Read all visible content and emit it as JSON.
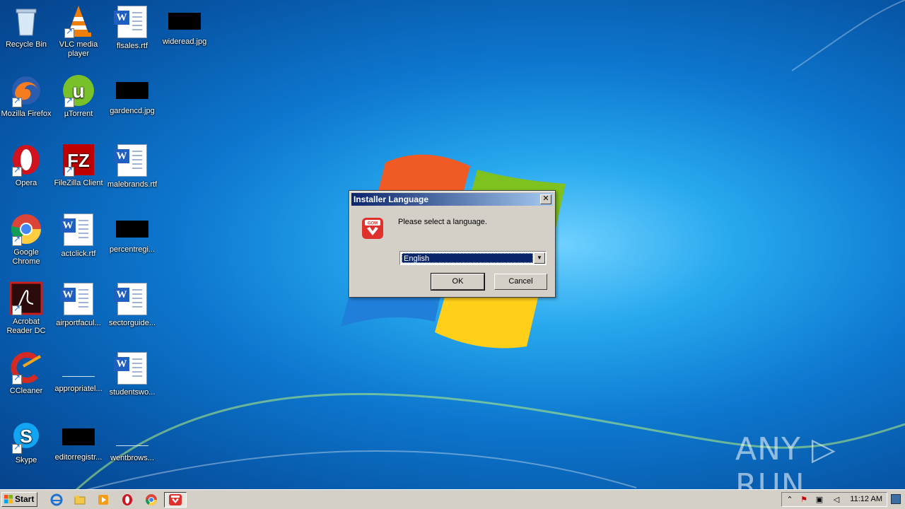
{
  "desktop": {
    "icons": [
      {
        "label": "Recycle Bin"
      },
      {
        "label": "VLC media player"
      },
      {
        "label": "flsales.rtf"
      },
      {
        "label": "wideread.jpg"
      },
      {
        "label": "Mozilla Firefox"
      },
      {
        "label": "µTorrent"
      },
      {
        "label": "gardencd.jpg"
      },
      {
        "label": "Opera"
      },
      {
        "label": "FileZilla Client"
      },
      {
        "label": "malebrands.rtf"
      },
      {
        "label": "Google Chrome"
      },
      {
        "label": "actclick.rtf"
      },
      {
        "label": "percentregi..."
      },
      {
        "label": "Acrobat Reader DC"
      },
      {
        "label": "airportfacul..."
      },
      {
        "label": "sectorguide..."
      },
      {
        "label": "CCleaner"
      },
      {
        "label": "appropriatel..."
      },
      {
        "label": "studentswo..."
      },
      {
        "label": "Skype"
      },
      {
        "label": "editorregistr..."
      },
      {
        "label": "wentbrows..."
      }
    ]
  },
  "dialog": {
    "title": "Installer Language",
    "close_glyph": "✕",
    "prompt": "Please select a language.",
    "language_select": {
      "value": "English"
    },
    "ok_label": "OK",
    "cancel_label": "Cancel"
  },
  "taskbar": {
    "start_label": "Start",
    "quick_launch": [
      "internet-explorer-icon",
      "windows-explorer-icon",
      "media-player-icon",
      "opera-icon",
      "chrome-icon"
    ],
    "active_app": "gom-player-installer",
    "tray": {
      "clock": "11:12 AM"
    }
  },
  "watermark": "ANY ▷ RUN",
  "colors": {
    "titlebar_start": "#0a246a",
    "titlebar_end": "#a6caf0",
    "dialog_bg": "#d4d0c8",
    "gom_red": "#e0302b"
  }
}
